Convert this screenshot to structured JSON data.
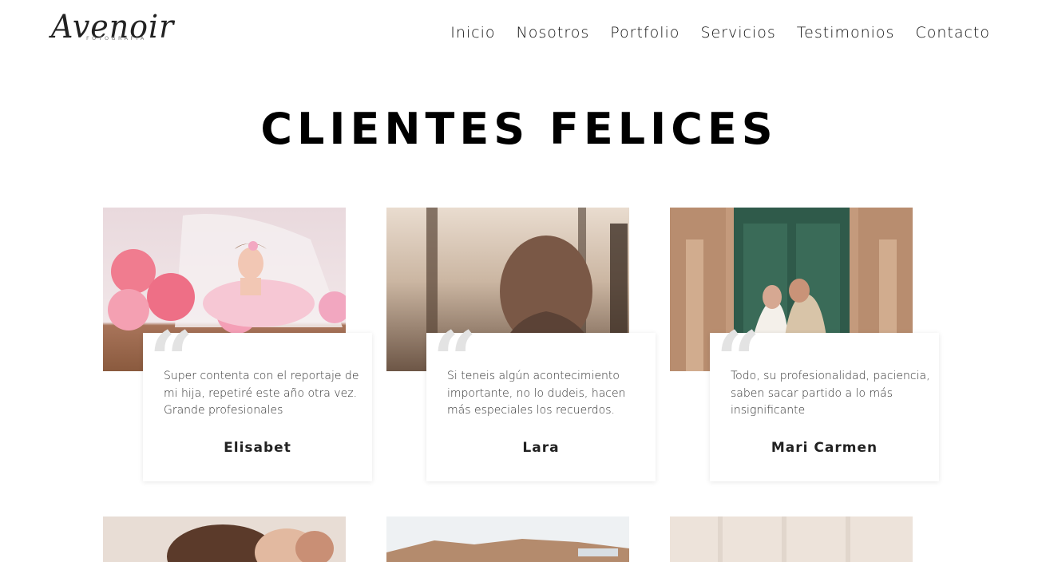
{
  "brand": {
    "logo_text": "Avenoir",
    "logo_subtext": "FOTOGRAFIA"
  },
  "nav": {
    "items": [
      {
        "label": "Inicio"
      },
      {
        "label": "Nosotros"
      },
      {
        "label": "Portfolio"
      },
      {
        "label": "Servicios"
      },
      {
        "label": "Testimonios"
      },
      {
        "label": "Contacto"
      }
    ]
  },
  "page": {
    "title": "CLIENTES FELICES"
  },
  "testimonials": [
    {
      "quote_mark": "“",
      "text": "Super contenta con el reportaje de mi hija, repetiré este año otra vez. Grande profesionales",
      "author": "Elisabet",
      "photo": "baby-with-pink-paper-balls-photo"
    },
    {
      "quote_mark": "“",
      "text": "Si teneis algún acontecimiento importante, no lo dudeis, hacen más especiales los recuerdos.",
      "author": "Lara",
      "photo": "woman-back-sunset-field-photo"
    },
    {
      "quote_mark": "“",
      "text": "Todo, su profesionalidad, paciencia, saben sacar partido a lo más insignificante",
      "author": "Mari Carmen",
      "photo": "couple-at-green-church-door-photo"
    }
  ],
  "colors": {
    "text": "#111111",
    "quote_mark": "#e3e3e3",
    "background": "#ffffff"
  }
}
